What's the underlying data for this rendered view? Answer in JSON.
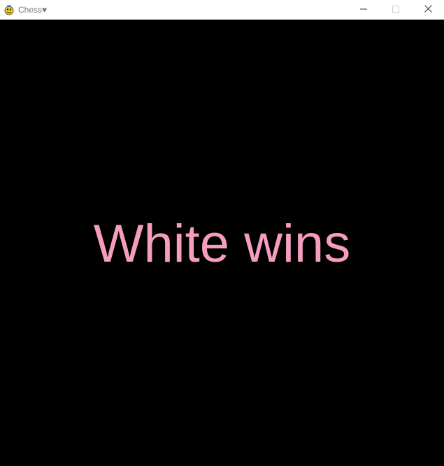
{
  "window": {
    "title": "Chess♥",
    "app_icon": "pygame-snake-icon",
    "controls": {
      "minimize_icon": "minimize-icon",
      "maximize_icon": "maximize-icon",
      "close_icon": "close-icon"
    }
  },
  "game": {
    "result_text": "White wins",
    "text_color": "#f59dbf",
    "background_color": "#000000"
  }
}
